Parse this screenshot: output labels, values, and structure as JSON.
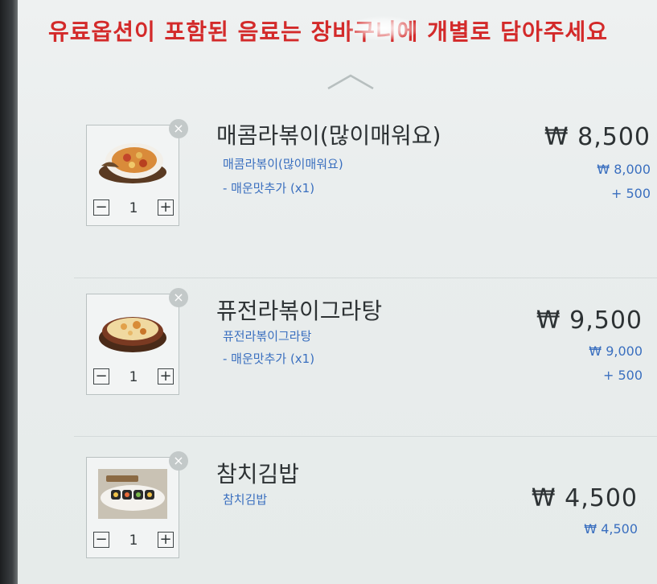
{
  "notice": "유료옵션이 포함된 음료는 장바구니에 개별로 담아주세요",
  "scroll_up_icon": "chevron-up-icon",
  "remove_icon": "close-circle-icon",
  "currency_symbol": "₩",
  "cart": {
    "items": [
      {
        "name": "매콤라볶이(많이매워요)",
        "base_name": "매콤라볶이(많이매워요)",
        "option": "- 매운맛추가 (x1)",
        "total_price": "₩ 8,500",
        "base_price": "₩ 8,000",
        "option_price": "+ 500",
        "quantity": "1",
        "image_icon": "spicy-rabokki-dish"
      },
      {
        "name": "퓨전라볶이그라탕",
        "base_name": "퓨전라볶이그라탕",
        "option": "- 매운맛추가 (x1)",
        "total_price": "₩ 9,500",
        "base_price": "₩ 9,000",
        "option_price": "+ 500",
        "quantity": "1",
        "image_icon": "rabokki-gratin-dish"
      },
      {
        "name": "참치김밥",
        "base_name": "참치김밥",
        "total_price": "₩ 4,500",
        "base_price": "₩ 4,500",
        "quantity": "1",
        "image_icon": "tuna-gimbap-plate"
      }
    ]
  },
  "qty_minus_label": "−",
  "qty_plus_label": "+",
  "remove_label": "×",
  "colors": {
    "notice": "#d32a2a",
    "option_text": "#3a6fbf",
    "main_text": "#2d3234"
  }
}
